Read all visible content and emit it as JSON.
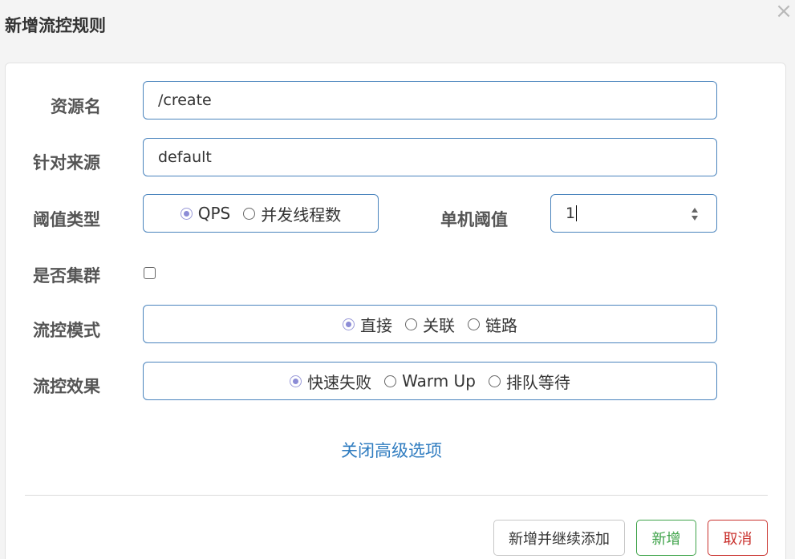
{
  "dialog": {
    "title": "新增流控规则",
    "close_symbol": "×"
  },
  "form": {
    "resource": {
      "label": "资源名",
      "value": "/create"
    },
    "source": {
      "label": "针对来源",
      "value": "default"
    },
    "threshold_type": {
      "label": "阈值类型",
      "options": [
        "QPS",
        "并发线程数"
      ],
      "selected": "QPS"
    },
    "threshold": {
      "label": "单机阈值",
      "value": "1"
    },
    "cluster": {
      "label": "是否集群",
      "checked": false
    },
    "mode": {
      "label": "流控模式",
      "options": [
        "直接",
        "关联",
        "链路"
      ],
      "selected": "直接"
    },
    "effect": {
      "label": "流控效果",
      "options": [
        "快速失败",
        "Warm Up",
        "排队等待"
      ],
      "selected": "快速失败"
    },
    "advanced_toggle": "关闭高级选项"
  },
  "footer": {
    "add_continue_label": "新增并继续添加",
    "add_label": "新增",
    "cancel_label": "取消"
  },
  "colors": {
    "link": "#2f7cc0",
    "border": "#4a84bd",
    "success": "#3fa34a",
    "danger": "#c9302c",
    "radio_checked": "#8c8cd6"
  }
}
